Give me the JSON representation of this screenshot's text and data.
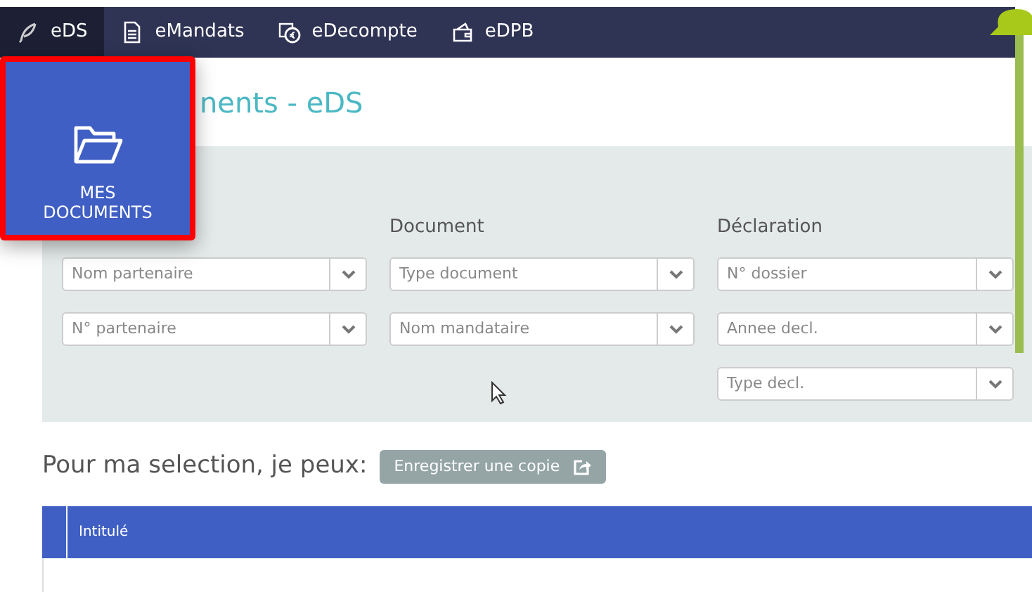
{
  "nav": [
    {
      "label": "eDS",
      "selected": true
    },
    {
      "label": "eMandats",
      "selected": false
    },
    {
      "label": "eDecompte",
      "selected": false
    },
    {
      "label": "eDPB",
      "selected": false
    }
  ],
  "tile": {
    "label": "MES DOCUMENTS"
  },
  "heading": "nents - eDS",
  "filter_columns": [
    {
      "fields": [
        {
          "placeholder": "Nom partenaire"
        },
        {
          "placeholder": "N° partenaire"
        }
      ]
    },
    {
      "label": "Document",
      "fields": [
        {
          "placeholder": "Type document"
        },
        {
          "placeholder": "Nom mandataire"
        }
      ]
    },
    {
      "label": "Déclaration",
      "fields": [
        {
          "placeholder": "N° dossier"
        },
        {
          "placeholder": "Annee decl."
        },
        {
          "placeholder": "Type decl."
        }
      ]
    }
  ],
  "action_text": "Pour ma selection, je peux:",
  "action_button": "Enregistrer une copie",
  "table": {
    "columns": [
      "Intitulé"
    ]
  }
}
